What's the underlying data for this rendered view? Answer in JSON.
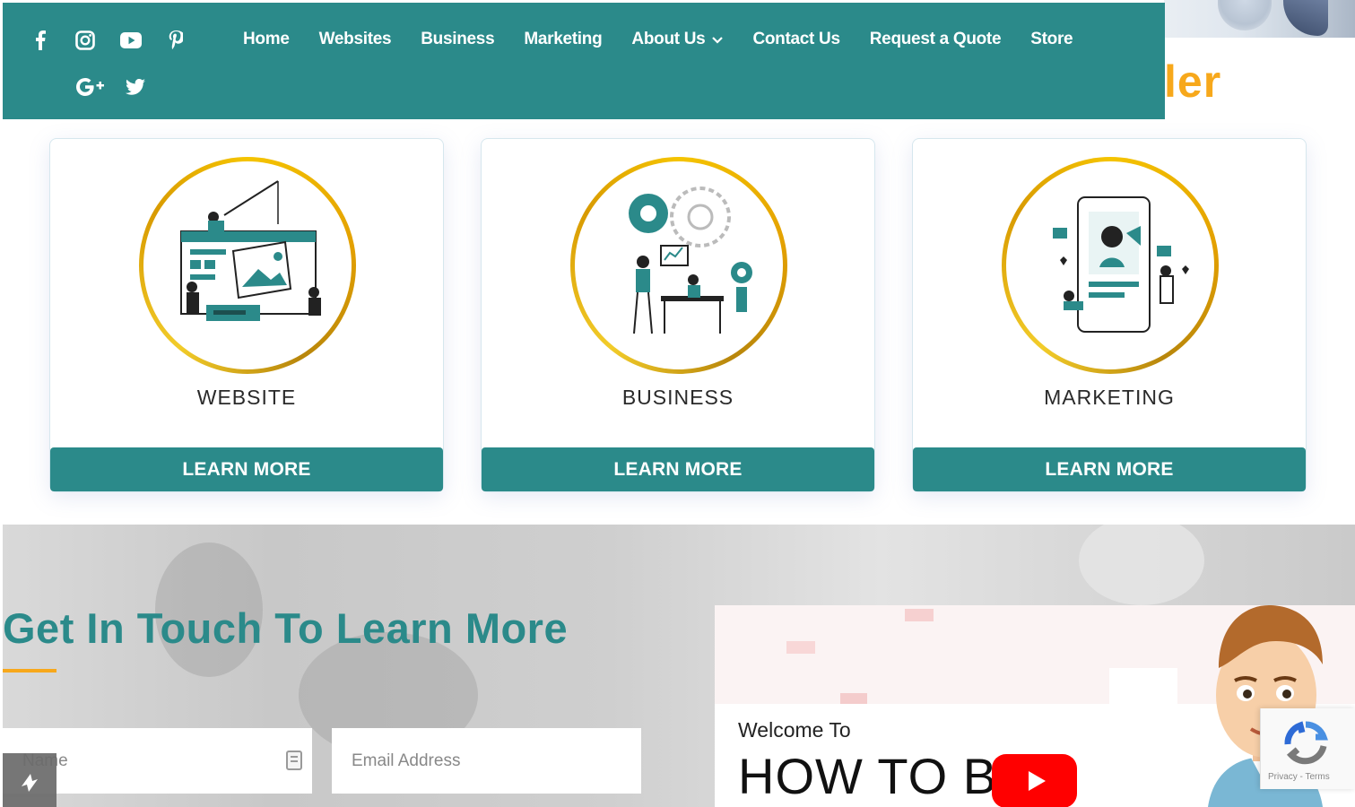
{
  "colors": {
    "primary_teal": "#2b8a8a",
    "accent_orange": "#f7a81b",
    "gold_ring": "#f5c400",
    "youtube_red": "#ff0000"
  },
  "header": {
    "title_fragment": "ler",
    "social_icons": [
      "facebook-icon",
      "instagram-icon",
      "youtube-icon",
      "pinterest-icon",
      "google-plus-icon",
      "twitter-icon"
    ]
  },
  "nav": {
    "items": [
      {
        "label": "Home"
      },
      {
        "label": "Websites"
      },
      {
        "label": "Business"
      },
      {
        "label": "Marketing"
      },
      {
        "label": "About Us",
        "has_dropdown": true
      },
      {
        "label": "Contact Us"
      },
      {
        "label": "Request a Quote"
      },
      {
        "label": "Store"
      }
    ]
  },
  "cards": [
    {
      "title": "WEBSITE",
      "button": "LEARN MORE",
      "illustration": "website-illustration"
    },
    {
      "title": "BUSINESS",
      "button": "LEARN MORE",
      "illustration": "business-illustration"
    },
    {
      "title": "MARKETING",
      "button": "LEARN MORE",
      "illustration": "marketing-illustration"
    }
  ],
  "contact": {
    "title": "Get In Touch To Learn More",
    "name_placeholder": "Name",
    "email_placeholder": "Email Address"
  },
  "video": {
    "welcome": "Welcome To",
    "title": "HOW TO BU",
    "recaptcha_text": "Privacy - Terms"
  }
}
